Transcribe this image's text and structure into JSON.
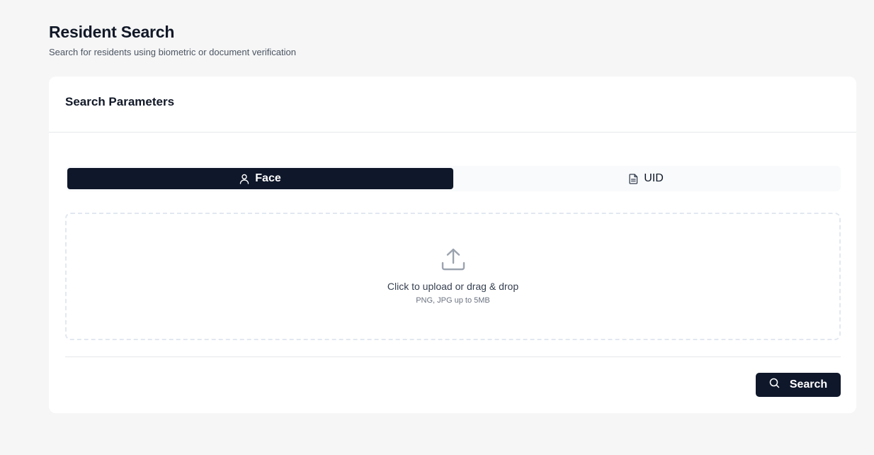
{
  "header": {
    "title": "Resident Search",
    "subtitle": "Search for residents using biometric or document verification"
  },
  "card": {
    "title": "Search Parameters"
  },
  "tabs": [
    {
      "label": "Face",
      "icon": "user-icon",
      "active": true
    },
    {
      "label": "UID",
      "icon": "document-icon",
      "active": false
    }
  ],
  "upload": {
    "icon": "upload-icon",
    "primary_text": "Click to upload or drag & drop",
    "secondary_text": "PNG, JPG up to 5MB"
  },
  "actions": {
    "search_label": "Search",
    "search_icon": "search-icon"
  },
  "colors": {
    "primary": "#0f172a",
    "background": "#f6f6f6",
    "card": "#ffffff"
  }
}
